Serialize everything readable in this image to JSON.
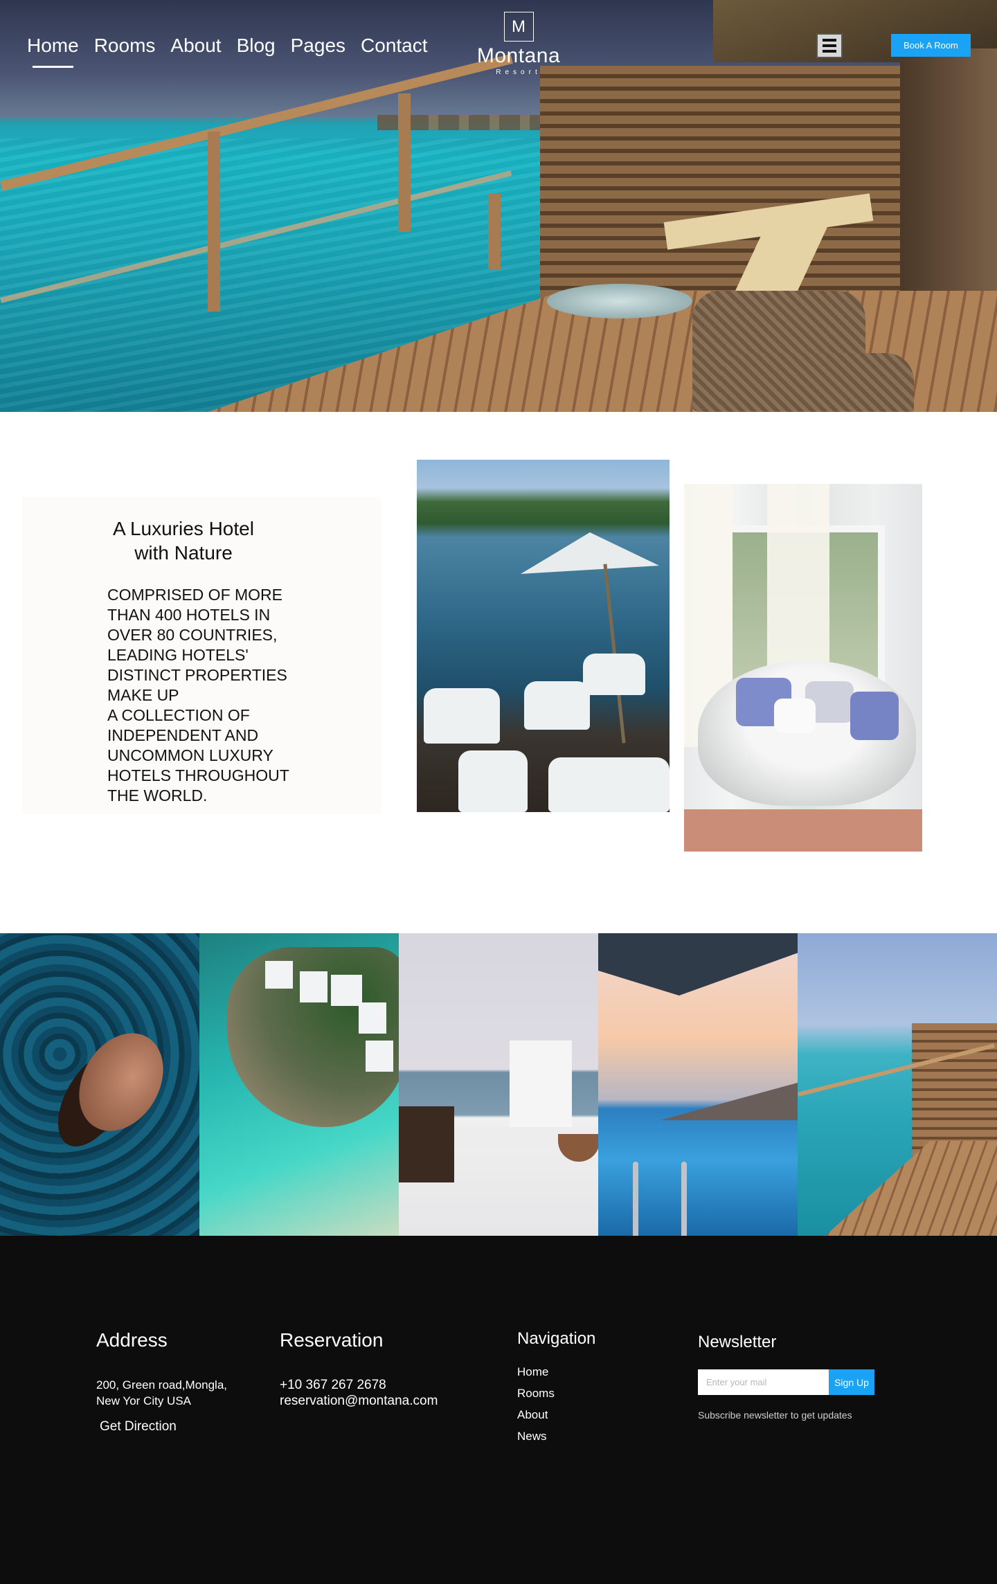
{
  "nav": {
    "items": [
      {
        "label": "Home",
        "active": true
      },
      {
        "label": "Rooms"
      },
      {
        "label": "About"
      },
      {
        "label": "Blog"
      },
      {
        "label": "Pages"
      },
      {
        "label": "Contact"
      }
    ]
  },
  "logo": {
    "mark": "M",
    "name": "Montana",
    "sub": "Resort"
  },
  "header": {
    "menu_icon": "hamburger-icon",
    "book_label": "Book A Room"
  },
  "intro": {
    "title": "A Luxuries Hotel with Nature",
    "body": "COMPRISED OF MORE THAN 400 HOTELS IN OVER 80 COUNTRIES, LEADING HOTELS' DISTINCT PROPERTIES MAKE UP\nA COLLECTION OF INDEPENDENT AND UNCOMMON LUXURY HOTELS THROUGHOUT THE WORLD."
  },
  "footer": {
    "address": {
      "heading": "Address",
      "line1": "200, Green road,Mongla,",
      "line2": "New Yor City USA",
      "direction_link": "Get Direction"
    },
    "reservation": {
      "heading": "Reservation",
      "phone": "+10 367 267 2678",
      "email": "reservation@montana.com"
    },
    "navigation": {
      "heading": "Navigation",
      "links": [
        "Home",
        "Rooms",
        "About",
        "News"
      ]
    },
    "newsletter": {
      "heading": "Newsletter",
      "placeholder": "Enter your mail",
      "button": "Sign Up",
      "note": "Subscribe newsletter to get updates"
    }
  },
  "colors": {
    "accent": "#1aa3f5",
    "footer_bg": "#0d0d0d"
  }
}
